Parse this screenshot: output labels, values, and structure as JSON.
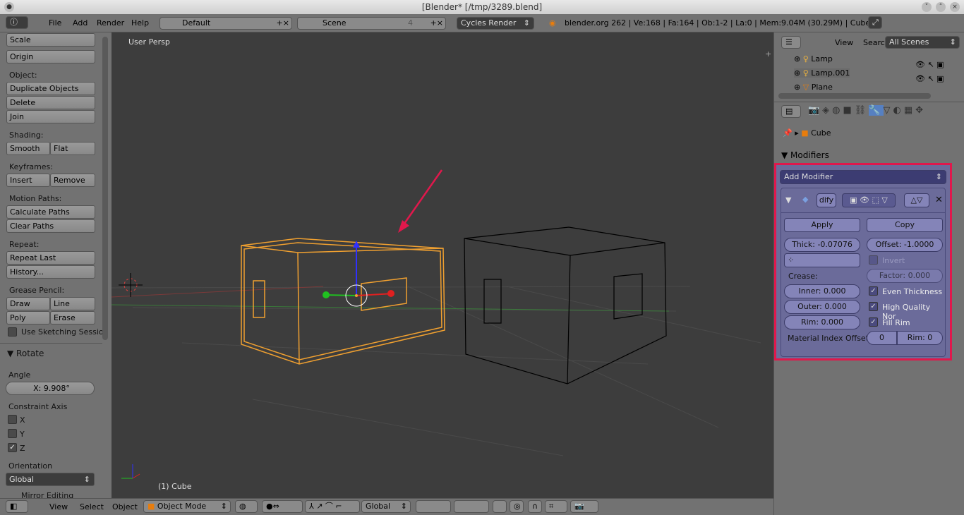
{
  "window": {
    "title": "[Blender* [/tmp/3289.blend]"
  },
  "topbar": {
    "menus": [
      "File",
      "Add",
      "Render",
      "Help"
    ],
    "layout": "Default",
    "scene": "Scene",
    "scene_count": "4",
    "engine": "Cycles Render",
    "stats": "blender.org 262 | Ve:168 | Fa:164 | Ob:1-2 | La:0 | Mem:9.04M (30.29M) | Cube"
  },
  "toolshelf": {
    "buttons_top": [
      "Scale",
      "Origin"
    ],
    "object_label": "Object:",
    "object_buttons": [
      "Duplicate Objects",
      "Delete",
      "Join"
    ],
    "shading_label": "Shading:",
    "shading": [
      "Smooth",
      "Flat"
    ],
    "keyframes_label": "Keyframes:",
    "keyframes": [
      "Insert",
      "Remove"
    ],
    "motion_label": "Motion Paths:",
    "motion": [
      "Calculate Paths",
      "Clear Paths"
    ],
    "repeat_label": "Repeat:",
    "repeat": [
      "Repeat Last",
      "History..."
    ],
    "grease_label": "Grease Pencil:",
    "grease": [
      "Draw",
      "Line",
      "Poly",
      "Erase"
    ],
    "sketching": "Use Sketching Sessio",
    "op_title": "Rotate",
    "angle_label": "Angle",
    "angle_value": "X: 9.908°",
    "constraint_label": "Constraint Axis",
    "axes": [
      {
        "name": "X",
        "checked": false
      },
      {
        "name": "Y",
        "checked": false
      },
      {
        "name": "Z",
        "checked": true
      }
    ],
    "orientation_label": "Orientation",
    "orientation": "Global",
    "mirror": "Mirror Editing"
  },
  "viewport": {
    "view_name": "User Persp",
    "object_label": "(1) Cube"
  },
  "bottombar": {
    "menus": [
      "View",
      "Select",
      "Object"
    ],
    "mode": "Object Mode",
    "orientation": "Global"
  },
  "outliner": {
    "menus": [
      "View",
      "Search"
    ],
    "scenes": "All Scenes",
    "items": [
      "Lamp",
      "Lamp.001",
      "Plane"
    ]
  },
  "properties": {
    "object": "Cube",
    "panel": "Modifiers",
    "add_modifier": "Add Modifier",
    "modifier_name": "dify",
    "apply": "Apply",
    "copy": "Copy",
    "thick": "Thick: -0.07076",
    "offset": "Offset: -1.0000",
    "invert": "Invert",
    "factor": "Factor: 0.000",
    "crease": "Crease:",
    "inner": "Inner: 0.000",
    "outer": "Outer: 0.000",
    "rim": "Rim: 0.000",
    "even": "Even Thickness",
    "hq": "High Quality Nor",
    "fill": "Fill Rim",
    "mat_label": "Material Index Offset",
    "mat_value": "0",
    "mat_rim": "Rim: 0"
  },
  "colors": {
    "highlight": "#e0184c",
    "selected": "#f0a030"
  }
}
